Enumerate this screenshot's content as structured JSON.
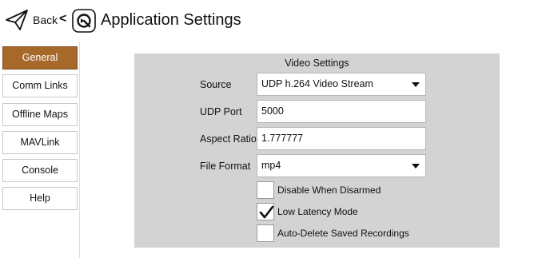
{
  "header": {
    "back_label": "Back",
    "back_chevron": "<",
    "title": "Application Settings",
    "back_icon": "paper-plane-icon",
    "app_icon": "qgc-logo-icon"
  },
  "sidebar": {
    "items": [
      {
        "label": "General",
        "active": true
      },
      {
        "label": "Comm Links",
        "active": false
      },
      {
        "label": "Offline Maps",
        "active": false
      },
      {
        "label": "MAVLink",
        "active": false
      },
      {
        "label": "Console",
        "active": false
      },
      {
        "label": "Help",
        "active": false
      }
    ],
    "active_color": "#a7692a"
  },
  "video_settings": {
    "title": "Video Settings",
    "source": {
      "label": "Source",
      "value": "UDP h.264 Video Stream"
    },
    "udp_port": {
      "label": "UDP Port",
      "value": "5000"
    },
    "aspect_ratio": {
      "label": "Aspect Ratio",
      "value": "1.777777"
    },
    "file_format": {
      "label": "File Format",
      "value": "mp4"
    },
    "options": [
      {
        "label": "Disable When Disarmed",
        "checked": false
      },
      {
        "label": "Low Latency Mode",
        "checked": true
      },
      {
        "label": "Auto-Delete Saved Recordings",
        "checked": false
      }
    ]
  }
}
